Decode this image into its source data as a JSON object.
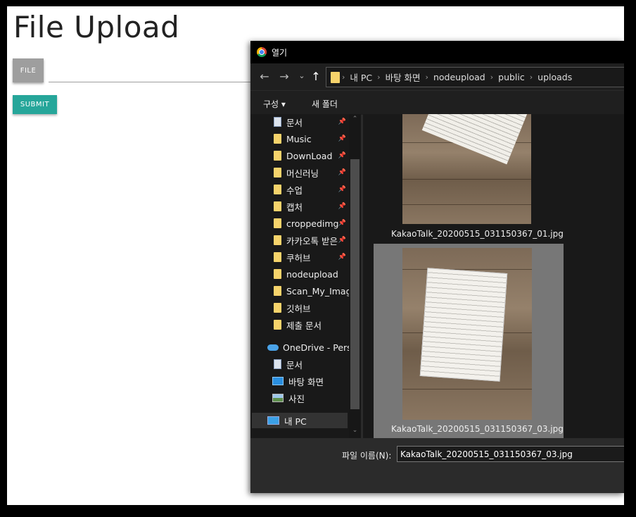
{
  "page": {
    "title": "File Upload",
    "file_button": "FILE",
    "submit_button": "SUBMIT"
  },
  "dialog": {
    "title": "열기",
    "nav": {
      "back": "←",
      "forward": "→",
      "recent": "⌄",
      "up": "↑"
    },
    "breadcrumb": [
      "내 PC",
      "바탕 화면",
      "nodeupload",
      "public",
      "uploads"
    ],
    "toolbar": {
      "organize": "구성 ▾",
      "new_folder": "새 폴더"
    },
    "sidebar": [
      {
        "label": "문서",
        "icon": "document-icon",
        "pinned": true
      },
      {
        "label": "Music",
        "icon": "folder-icon",
        "pinned": true
      },
      {
        "label": "DownLoad",
        "icon": "folder-icon",
        "pinned": true
      },
      {
        "label": "머신러닝",
        "icon": "folder-icon",
        "pinned": true
      },
      {
        "label": "수업",
        "icon": "folder-icon",
        "pinned": true
      },
      {
        "label": "캡처",
        "icon": "folder-icon",
        "pinned": true
      },
      {
        "label": "croppedimg",
        "icon": "folder-icon",
        "pinned": true
      },
      {
        "label": "카카오톡 받은",
        "icon": "folder-icon",
        "pinned": true
      },
      {
        "label": "쿠허브",
        "icon": "folder-icon",
        "pinned": true
      },
      {
        "label": "nodeupload",
        "icon": "folder-icon",
        "pinned": false
      },
      {
        "label": "Scan_My_Image",
        "icon": "folder-icon",
        "pinned": false
      },
      {
        "label": "깃허브",
        "icon": "folder-icon",
        "pinned": false
      },
      {
        "label": "제출 문서",
        "icon": "folder-icon",
        "pinned": false
      },
      {
        "label": "OneDrive - Person",
        "icon": "cloud-icon",
        "pinned": false
      },
      {
        "label": "문서",
        "icon": "document-icon",
        "pinned": false
      },
      {
        "label": "바탕 화면",
        "icon": "desktop-icon",
        "pinned": false
      },
      {
        "label": "사진",
        "icon": "pictures-icon",
        "pinned": false
      },
      {
        "label": "내 PC",
        "icon": "pc-icon",
        "pinned": false,
        "selected": true
      }
    ],
    "files": [
      {
        "name": "KakaoTalk_20200515_031150367_01.jpg",
        "selected": false
      },
      {
        "name": "KakaoTalk_20200515_031150367_03.jpg",
        "selected": true
      }
    ],
    "filename_label": "파일 이름(N):",
    "filename_value": "KakaoTalk_20200515_031150367_03.jpg"
  }
}
